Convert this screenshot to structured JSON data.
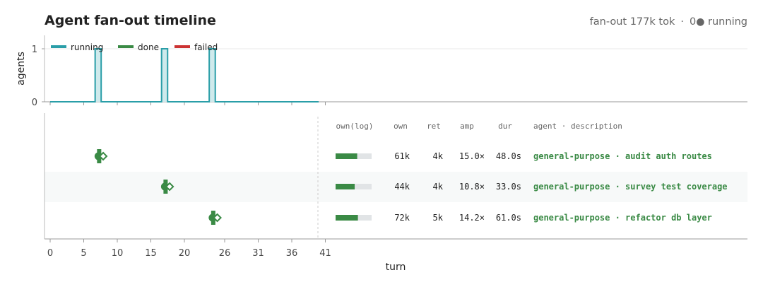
{
  "header": {
    "title": "Agent fan-out timeline",
    "fanout_label": "fan-out 177k tok",
    "separator": "·",
    "running_count": "0",
    "running_dot": "●",
    "running_label": "running"
  },
  "colors": {
    "running": "#2a9ea8",
    "done": "#3a8a45",
    "failed": "#cc3333",
    "running_fill": "#cfeaec",
    "bar_bg": "#e1e4e6",
    "text_dim": "#666666",
    "label_green": "#3a8a45"
  },
  "chart_data": [
    {
      "type": "area",
      "ylabel": "agents",
      "ylim": [
        0,
        1
      ],
      "y_ticks": [
        "0",
        "1"
      ],
      "legend_placement": "top-left",
      "legend": [
        {
          "name": "running",
          "color": "#2a9ea8"
        },
        {
          "name": "done",
          "color": "#3a8a45"
        },
        {
          "name": "failed",
          "color": "#cc3333"
        }
      ],
      "steps": [
        {
          "start": 6.7,
          "end": 7.6,
          "value": 1
        },
        {
          "start": 16.6,
          "end": 17.5,
          "value": 1
        },
        {
          "start": 23.7,
          "end": 24.6,
          "value": 1
        }
      ],
      "x_end": 40
    },
    {
      "type": "scatter",
      "xlabel": "turn",
      "x_ticks": [
        "0",
        "5",
        "10",
        "15",
        "20",
        "26",
        "31",
        "36",
        "41"
      ],
      "x_tick_values": [
        0,
        5,
        10,
        15,
        20,
        26,
        31,
        36,
        41
      ],
      "divider_turn": 40,
      "table_headers": [
        "own(log)",
        "own",
        "ret",
        "amp",
        "dur",
        "agent · description"
      ],
      "rows": [
        {
          "start": 7.3,
          "end": 7.9,
          "own": "61k",
          "ret": "4k",
          "amp": "15.0×",
          "dur": "48.0s",
          "own_frac": 0.6,
          "label": "general-purpose · audit auth routes",
          "status": "done"
        },
        {
          "start": 17.2,
          "end": 17.8,
          "own": "44k",
          "ret": "4k",
          "amp": "10.8×",
          "dur": "33.0s",
          "own_frac": 0.53,
          "label": "general-purpose · survey test coverage",
          "status": "done"
        },
        {
          "start": 24.3,
          "end": 24.9,
          "own": "72k",
          "ret": "5k",
          "amp": "14.2×",
          "dur": "61.0s",
          "own_frac": 0.62,
          "label": "general-purpose · refactor db layer",
          "status": "done"
        }
      ]
    }
  ]
}
